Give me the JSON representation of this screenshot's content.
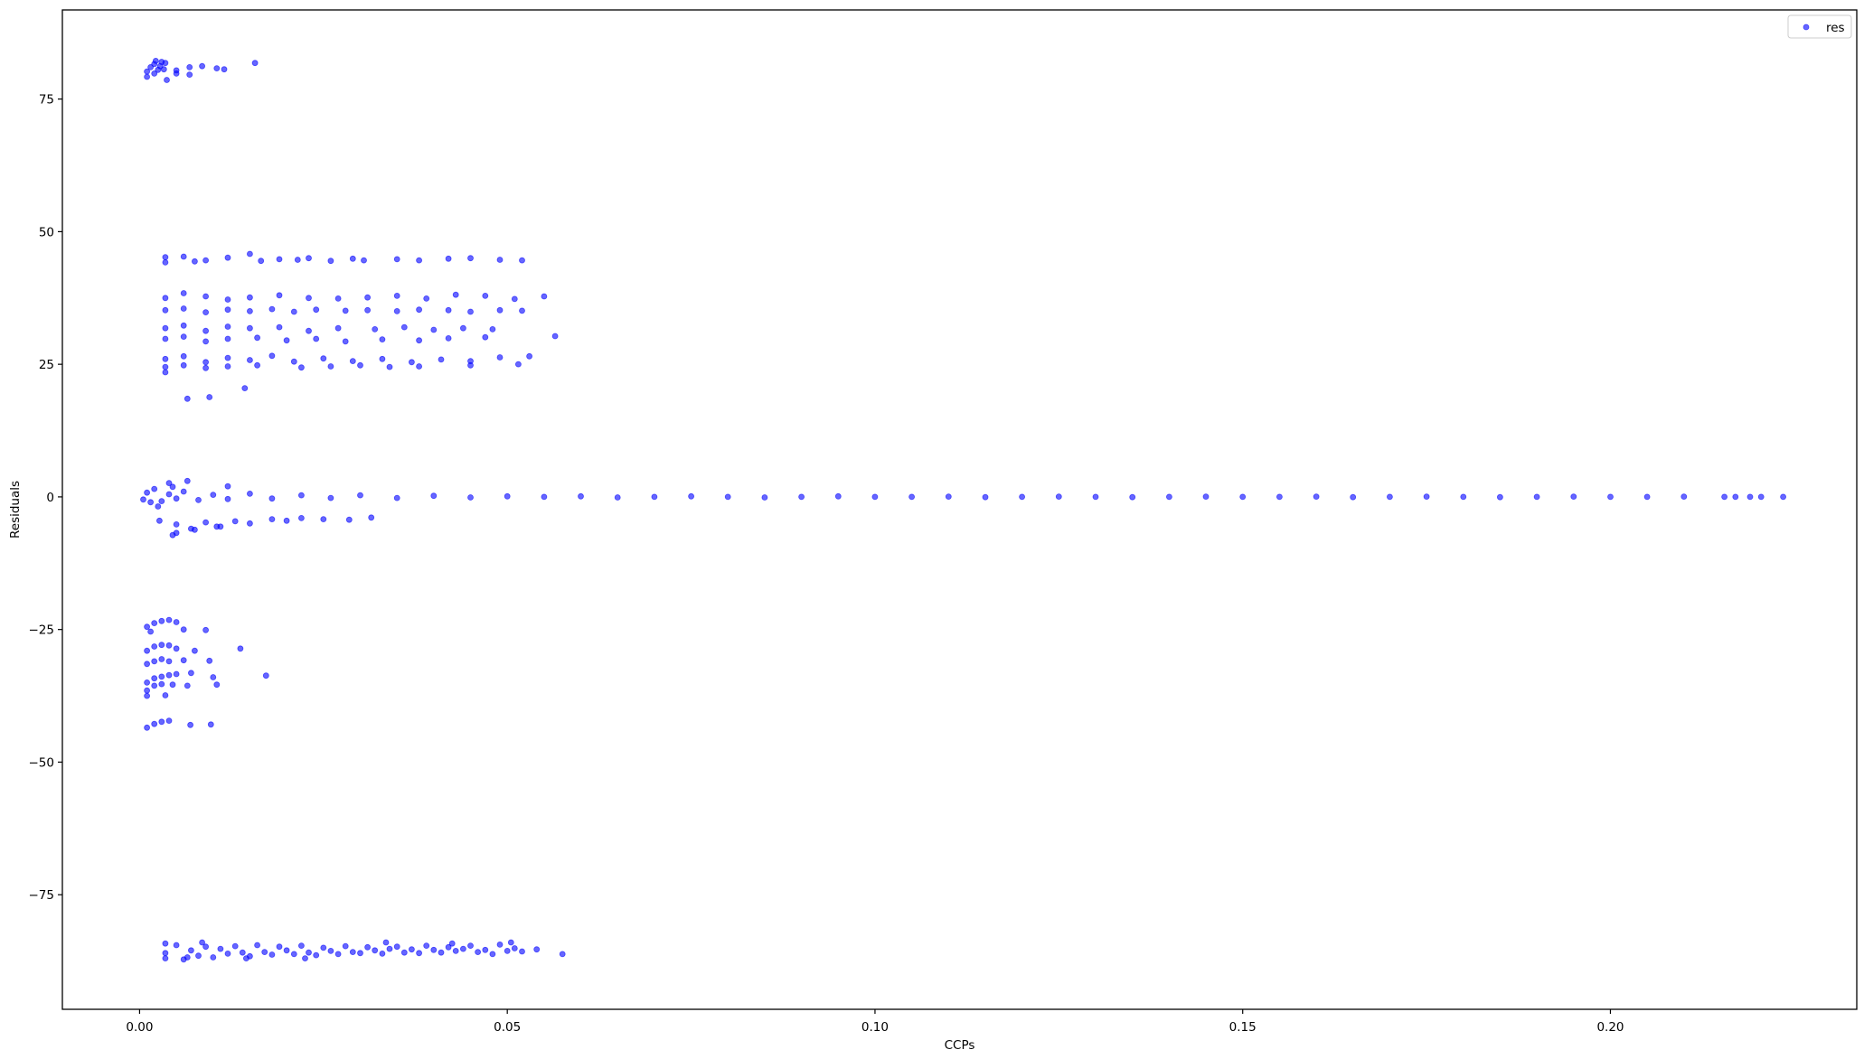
{
  "chart_data": {
    "type": "scatter",
    "title": "",
    "xlabel": "CCPs",
    "ylabel": "Residuals",
    "xlim": [
      -0.0105,
      0.2335
    ],
    "ylim": [
      -96.6,
      91.8
    ],
    "xticks": [
      0.0,
      0.05,
      0.1,
      0.15,
      0.2
    ],
    "xtick_labels": [
      "0.00",
      "0.05",
      "0.10",
      "0.15",
      "0.20"
    ],
    "yticks": [
      -75,
      -50,
      -25,
      0,
      25,
      50,
      75
    ],
    "ytick_labels": [
      "−75",
      "−50",
      "−25",
      "0",
      "25",
      "50",
      "75"
    ],
    "grid": false,
    "legend": {
      "position": "top-right",
      "entries": [
        "res"
      ]
    },
    "series": [
      {
        "name": "res",
        "color": "#0000ff",
        "alpha": 0.6,
        "marker_size": 3,
        "points": [
          [
            0.001,
            80.2
          ],
          [
            0.0015,
            81.0
          ],
          [
            0.002,
            81.6
          ],
          [
            0.0025,
            80.5
          ],
          [
            0.003,
            82.0
          ],
          [
            0.0035,
            81.8
          ],
          [
            0.001,
            79.2
          ],
          [
            0.002,
            79.8
          ],
          [
            0.0028,
            81.2
          ],
          [
            0.0033,
            80.6
          ],
          [
            0.005,
            80.4
          ],
          [
            0.0068,
            79.6
          ],
          [
            0.0085,
            81.2
          ],
          [
            0.0105,
            80.8
          ],
          [
            0.0157,
            81.8
          ],
          [
            0.0037,
            78.6
          ],
          [
            0.005,
            79.8
          ],
          [
            0.0068,
            81.0
          ],
          [
            0.0115,
            80.6
          ],
          [
            0.0022,
            82.2
          ],
          [
            0.0035,
            44.2
          ],
          [
            0.006,
            45.3
          ],
          [
            0.009,
            44.6
          ],
          [
            0.012,
            45.1
          ],
          [
            0.015,
            45.8
          ],
          [
            0.019,
            44.8
          ],
          [
            0.023,
            45.0
          ],
          [
            0.026,
            44.5
          ],
          [
            0.029,
            44.9
          ],
          [
            0.035,
            44.8
          ],
          [
            0.038,
            44.6
          ],
          [
            0.042,
            44.9
          ],
          [
            0.045,
            45.0
          ],
          [
            0.049,
            44.7
          ],
          [
            0.052,
            44.6
          ],
          [
            0.0035,
            45.2
          ],
          [
            0.0075,
            44.4
          ],
          [
            0.0165,
            44.5
          ],
          [
            0.0215,
            44.7
          ],
          [
            0.0305,
            44.6
          ],
          [
            0.0035,
            37.5
          ],
          [
            0.006,
            38.4
          ],
          [
            0.009,
            37.8
          ],
          [
            0.012,
            37.2
          ],
          [
            0.015,
            37.6
          ],
          [
            0.019,
            38.0
          ],
          [
            0.023,
            37.5
          ],
          [
            0.027,
            37.4
          ],
          [
            0.031,
            37.6
          ],
          [
            0.035,
            37.9
          ],
          [
            0.039,
            37.4
          ],
          [
            0.043,
            38.1
          ],
          [
            0.047,
            37.9
          ],
          [
            0.051,
            37.3
          ],
          [
            0.055,
            37.8
          ],
          [
            0.0035,
            35.2
          ],
          [
            0.006,
            35.5
          ],
          [
            0.009,
            34.8
          ],
          [
            0.012,
            35.3
          ],
          [
            0.015,
            35.0
          ],
          [
            0.018,
            35.4
          ],
          [
            0.021,
            34.9
          ],
          [
            0.024,
            35.3
          ],
          [
            0.028,
            35.1
          ],
          [
            0.031,
            35.2
          ],
          [
            0.035,
            35.0
          ],
          [
            0.038,
            35.3
          ],
          [
            0.042,
            35.2
          ],
          [
            0.045,
            34.9
          ],
          [
            0.049,
            35.2
          ],
          [
            0.052,
            35.1
          ],
          [
            0.0035,
            31.8
          ],
          [
            0.006,
            32.3
          ],
          [
            0.009,
            31.3
          ],
          [
            0.012,
            32.1
          ],
          [
            0.015,
            31.8
          ],
          [
            0.019,
            32.0
          ],
          [
            0.023,
            31.3
          ],
          [
            0.027,
            31.8
          ],
          [
            0.032,
            31.6
          ],
          [
            0.036,
            32.0
          ],
          [
            0.04,
            31.5
          ],
          [
            0.044,
            31.8
          ],
          [
            0.048,
            31.6
          ],
          [
            0.0035,
            29.8
          ],
          [
            0.006,
            30.2
          ],
          [
            0.009,
            29.3
          ],
          [
            0.012,
            29.8
          ],
          [
            0.016,
            30.0
          ],
          [
            0.02,
            29.5
          ],
          [
            0.024,
            29.8
          ],
          [
            0.028,
            29.3
          ],
          [
            0.033,
            29.7
          ],
          [
            0.038,
            29.5
          ],
          [
            0.042,
            29.9
          ],
          [
            0.047,
            30.1
          ],
          [
            0.0565,
            30.3
          ],
          [
            0.0035,
            26.0
          ],
          [
            0.006,
            26.5
          ],
          [
            0.009,
            25.4
          ],
          [
            0.012,
            26.2
          ],
          [
            0.015,
            25.8
          ],
          [
            0.018,
            26.6
          ],
          [
            0.021,
            25.5
          ],
          [
            0.025,
            26.1
          ],
          [
            0.029,
            25.6
          ],
          [
            0.033,
            26.0
          ],
          [
            0.037,
            25.4
          ],
          [
            0.041,
            25.9
          ],
          [
            0.045,
            25.6
          ],
          [
            0.049,
            26.3
          ],
          [
            0.053,
            26.5
          ],
          [
            0.0035,
            24.5
          ],
          [
            0.006,
            24.8
          ],
          [
            0.009,
            24.3
          ],
          [
            0.012,
            24.6
          ],
          [
            0.016,
            24.8
          ],
          [
            0.022,
            24.4
          ],
          [
            0.026,
            24.6
          ],
          [
            0.03,
            24.8
          ],
          [
            0.034,
            24.5
          ],
          [
            0.038,
            24.6
          ],
          [
            0.045,
            24.8
          ],
          [
            0.0515,
            25.0
          ],
          [
            0.0035,
            23.5
          ],
          [
            0.0065,
            18.5
          ],
          [
            0.0095,
            18.8
          ],
          [
            0.0143,
            20.5
          ],
          [
            0.0005,
            -0.5
          ],
          [
            0.001,
            0.8
          ],
          [
            0.0015,
            -1.0
          ],
          [
            0.002,
            1.5
          ],
          [
            0.003,
            -0.8
          ],
          [
            0.004,
            0.5
          ],
          [
            0.005,
            -0.3
          ],
          [
            0.006,
            1.0
          ],
          [
            0.008,
            -0.6
          ],
          [
            0.01,
            0.4
          ],
          [
            0.012,
            -0.4
          ],
          [
            0.015,
            0.6
          ],
          [
            0.018,
            -0.3
          ],
          [
            0.022,
            0.3
          ],
          [
            0.026,
            -0.2
          ],
          [
            0.03,
            0.3
          ],
          [
            0.035,
            -0.2
          ],
          [
            0.04,
            0.2
          ],
          [
            0.045,
            -0.1
          ],
          [
            0.05,
            0.1
          ],
          [
            0.055,
            0.0
          ],
          [
            0.06,
            0.1
          ],
          [
            0.065,
            -0.1
          ],
          [
            0.07,
            0.0
          ],
          [
            0.075,
            0.1
          ],
          [
            0.08,
            0.0
          ],
          [
            0.085,
            -0.1
          ],
          [
            0.09,
            0.0
          ],
          [
            0.095,
            0.1
          ],
          [
            0.1,
            0.0
          ],
          [
            0.105,
            0.0
          ],
          [
            0.11,
            0.05
          ],
          [
            0.115,
            -0.05
          ],
          [
            0.12,
            0.0
          ],
          [
            0.125,
            0.05
          ],
          [
            0.13,
            0.0
          ],
          [
            0.135,
            -0.05
          ],
          [
            0.14,
            0.0
          ],
          [
            0.145,
            0.05
          ],
          [
            0.15,
            0.0
          ],
          [
            0.155,
            0.0
          ],
          [
            0.16,
            0.05
          ],
          [
            0.165,
            -0.05
          ],
          [
            0.17,
            0.0
          ],
          [
            0.175,
            0.05
          ],
          [
            0.18,
            0.0
          ],
          [
            0.185,
            -0.05
          ],
          [
            0.19,
            0.0
          ],
          [
            0.195,
            0.05
          ],
          [
            0.2,
            0.0
          ],
          [
            0.205,
            0.0
          ],
          [
            0.21,
            0.05
          ],
          [
            0.2155,
            0.0
          ],
          [
            0.217,
            0.0
          ],
          [
            0.219,
            0.0
          ],
          [
            0.2205,
            0.0
          ],
          [
            0.2235,
            0.0
          ],
          [
            0.0065,
            3.0
          ],
          [
            0.004,
            2.6
          ],
          [
            0.012,
            2.0
          ],
          [
            0.0025,
            -1.8
          ],
          [
            0.0045,
            1.9
          ],
          [
            0.0027,
            -4.5
          ],
          [
            0.005,
            -5.2
          ],
          [
            0.007,
            -6.0
          ],
          [
            0.009,
            -4.8
          ],
          [
            0.011,
            -5.6
          ],
          [
            0.013,
            -4.6
          ],
          [
            0.015,
            -5.0
          ],
          [
            0.018,
            -4.2
          ],
          [
            0.02,
            -4.5
          ],
          [
            0.022,
            -4.0
          ],
          [
            0.025,
            -4.2
          ],
          [
            0.0285,
            -4.3
          ],
          [
            0.0315,
            -3.9
          ],
          [
            0.005,
            -6.8
          ],
          [
            0.0075,
            -6.2
          ],
          [
            0.0105,
            -5.6
          ],
          [
            0.0045,
            -7.2
          ],
          [
            0.001,
            -24.5
          ],
          [
            0.002,
            -23.8
          ],
          [
            0.003,
            -23.4
          ],
          [
            0.004,
            -23.2
          ],
          [
            0.005,
            -23.6
          ],
          [
            0.006,
            -25.0
          ],
          [
            0.009,
            -25.1
          ],
          [
            0.0015,
            -25.4
          ],
          [
            0.001,
            -29.0
          ],
          [
            0.002,
            -28.2
          ],
          [
            0.003,
            -27.9
          ],
          [
            0.004,
            -28.0
          ],
          [
            0.005,
            -28.6
          ],
          [
            0.0075,
            -29.0
          ],
          [
            0.0137,
            -28.6
          ],
          [
            0.001,
            -31.5
          ],
          [
            0.002,
            -31.0
          ],
          [
            0.003,
            -30.6
          ],
          [
            0.004,
            -31.0
          ],
          [
            0.006,
            -30.8
          ],
          [
            0.0095,
            -30.9
          ],
          [
            0.001,
            -35.0
          ],
          [
            0.002,
            -34.2
          ],
          [
            0.003,
            -33.9
          ],
          [
            0.004,
            -33.6
          ],
          [
            0.005,
            -33.4
          ],
          [
            0.007,
            -33.2
          ],
          [
            0.01,
            -34.0
          ],
          [
            0.0172,
            -33.7
          ],
          [
            0.001,
            -36.5
          ],
          [
            0.002,
            -35.6
          ],
          [
            0.003,
            -35.3
          ],
          [
            0.0045,
            -35.4
          ],
          [
            0.0065,
            -35.6
          ],
          [
            0.0105,
            -35.4
          ],
          [
            0.001,
            -37.5
          ],
          [
            0.0035,
            -37.4
          ],
          [
            0.001,
            -43.5
          ],
          [
            0.002,
            -42.8
          ],
          [
            0.003,
            -42.4
          ],
          [
            0.004,
            -42.2
          ],
          [
            0.0069,
            -43.0
          ],
          [
            0.0097,
            -42.9
          ],
          [
            0.0035,
            -86.0
          ],
          [
            0.005,
            -84.5
          ],
          [
            0.006,
            -87.2
          ],
          [
            0.007,
            -85.5
          ],
          [
            0.008,
            -86.5
          ],
          [
            0.009,
            -84.8
          ],
          [
            0.01,
            -86.8
          ],
          [
            0.011,
            -85.2
          ],
          [
            0.012,
            -86.1
          ],
          [
            0.013,
            -84.7
          ],
          [
            0.014,
            -85.9
          ],
          [
            0.015,
            -86.6
          ],
          [
            0.016,
            -84.5
          ],
          [
            0.017,
            -85.8
          ],
          [
            0.018,
            -86.3
          ],
          [
            0.019,
            -84.8
          ],
          [
            0.02,
            -85.5
          ],
          [
            0.021,
            -86.2
          ],
          [
            0.022,
            -84.6
          ],
          [
            0.023,
            -85.9
          ],
          [
            0.024,
            -86.4
          ],
          [
            0.025,
            -85.0
          ],
          [
            0.026,
            -85.6
          ],
          [
            0.027,
            -86.2
          ],
          [
            0.028,
            -84.7
          ],
          [
            0.029,
            -85.8
          ],
          [
            0.03,
            -86.0
          ],
          [
            0.031,
            -84.9
          ],
          [
            0.032,
            -85.5
          ],
          [
            0.033,
            -86.1
          ],
          [
            0.034,
            -85.2
          ],
          [
            0.035,
            -84.8
          ],
          [
            0.036,
            -85.9
          ],
          [
            0.037,
            -85.3
          ],
          [
            0.038,
            -86.0
          ],
          [
            0.039,
            -84.6
          ],
          [
            0.04,
            -85.4
          ],
          [
            0.041,
            -85.9
          ],
          [
            0.042,
            -84.9
          ],
          [
            0.043,
            -85.6
          ],
          [
            0.044,
            -85.2
          ],
          [
            0.045,
            -84.6
          ],
          [
            0.046,
            -85.8
          ],
          [
            0.047,
            -85.4
          ],
          [
            0.048,
            -86.2
          ],
          [
            0.049,
            -84.4
          ],
          [
            0.05,
            -85.6
          ],
          [
            0.051,
            -85.1
          ],
          [
            0.052,
            -85.7
          ],
          [
            0.054,
            -85.3
          ],
          [
            0.0575,
            -86.2
          ],
          [
            0.0035,
            -84.2
          ],
          [
            0.0035,
            -87.0
          ],
          [
            0.0065,
            -86.8
          ],
          [
            0.0085,
            -84.0
          ],
          [
            0.0145,
            -87.0
          ],
          [
            0.0225,
            -87.0
          ],
          [
            0.0335,
            -84.0
          ],
          [
            0.0425,
            -84.2
          ],
          [
            0.0505,
            -84.0
          ]
        ]
      }
    ]
  }
}
